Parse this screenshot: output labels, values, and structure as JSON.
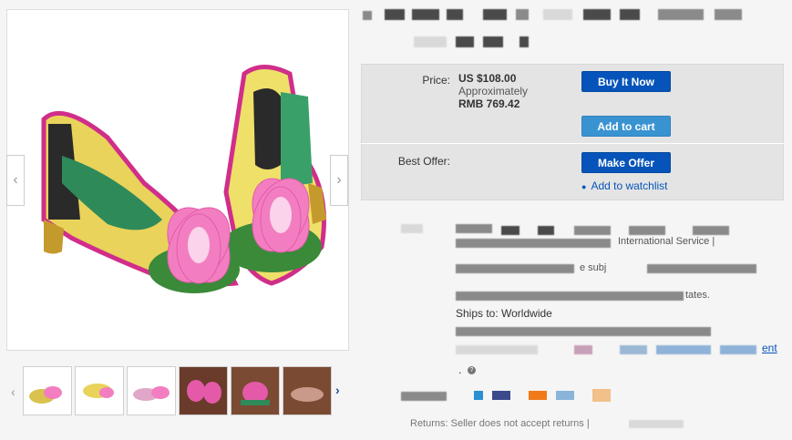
{
  "gallery": {
    "prev_icon": "chevron-left-icon",
    "next_icon": "chevron-right-icon",
    "thumbs_prev_icon": "chevron-left-icon",
    "thumbs_next_icon": "chevron-right-icon",
    "thumbnail_count": 6
  },
  "purchase": {
    "price_label": "Price:",
    "price_value": "US $108.00",
    "approx_label": "Approximately",
    "approx_value": "RMB 769.42",
    "buy_now_label": "Buy It Now",
    "add_to_cart_label": "Add to cart",
    "best_offer_label": "Best Offer:",
    "make_offer_label": "Make Offer",
    "watchlist_label": "Add to watchlist"
  },
  "details": {
    "shipping_fragment": "International Service |",
    "delivery_fragment": "e subj",
    "states_fragment": "tates.",
    "ships_to": "Ships to: Worldwide",
    "link_fragment": "ent",
    "returns_fragment": "Returns:  Seller does not accept returns |"
  },
  "colors": {
    "button_primary": "#0654ba",
    "button_secondary": "#3a93d1",
    "panel_bg": "#e4e4e4",
    "link": "#0654ba"
  }
}
